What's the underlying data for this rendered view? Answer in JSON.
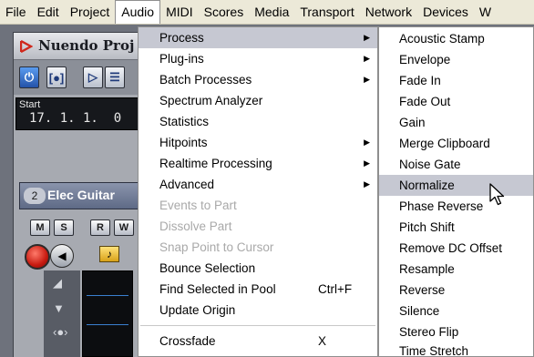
{
  "menubar": {
    "items": [
      "File",
      "Edit",
      "Project",
      "Audio",
      "MIDI",
      "Scores",
      "Media",
      "Transport",
      "Network",
      "Devices",
      "W"
    ]
  },
  "project": {
    "title": "Nuendo Proj",
    "transport_label": "Start",
    "transport_position": "17. 1. 1.  0",
    "track_number": "2",
    "track_name": "Elec Guitar",
    "buttons": {
      "mute": "M",
      "solo": "S",
      "read": "R",
      "write": "W"
    }
  },
  "audio_menu": {
    "items": [
      {
        "label": "Process",
        "submenu": true,
        "highlighted": true
      },
      {
        "label": "Plug-ins",
        "submenu": true
      },
      {
        "label": "Batch Processes",
        "submenu": true
      },
      {
        "label": "Spectrum Analyzer"
      },
      {
        "label": "Statistics"
      },
      {
        "label": "Hitpoints",
        "submenu": true
      },
      {
        "label": "Realtime Processing",
        "submenu": true
      },
      {
        "label": "Advanced",
        "submenu": true
      },
      {
        "label": "Events to Part",
        "disabled": true
      },
      {
        "label": "Dissolve Part",
        "disabled": true
      },
      {
        "label": "Snap Point to Cursor",
        "disabled": true
      },
      {
        "label": "Bounce Selection"
      },
      {
        "label": "Find Selected in Pool",
        "shortcut": "Ctrl+F"
      },
      {
        "label": "Update Origin"
      },
      {
        "label": "Crossfade",
        "shortcut": "X"
      }
    ]
  },
  "process_menu": {
    "items": [
      {
        "label": "Acoustic Stamp"
      },
      {
        "label": "Envelope"
      },
      {
        "label": "Fade In"
      },
      {
        "label": "Fade Out"
      },
      {
        "label": "Gain"
      },
      {
        "label": "Merge Clipboard"
      },
      {
        "label": "Noise Gate"
      },
      {
        "label": "Normalize",
        "highlighted": true
      },
      {
        "label": "Phase Reverse"
      },
      {
        "label": "Pitch Shift"
      },
      {
        "label": "Remove DC Offset"
      },
      {
        "label": "Resample"
      },
      {
        "label": "Reverse"
      },
      {
        "label": "Silence"
      },
      {
        "label": "Stereo Flip"
      },
      {
        "label": "Time Stretch"
      }
    ]
  },
  "icons": {
    "submenu_arrow": "triangle-right-icon",
    "cursor": "arrow-pointer-icon",
    "logo": "nuendo-logo-icon"
  },
  "colors": {
    "menu_highlight": "#c6c8d2",
    "menubar_bg": "#ece9d8",
    "disabled_text": "#a9a9a9",
    "record_red": "#c71a10"
  }
}
